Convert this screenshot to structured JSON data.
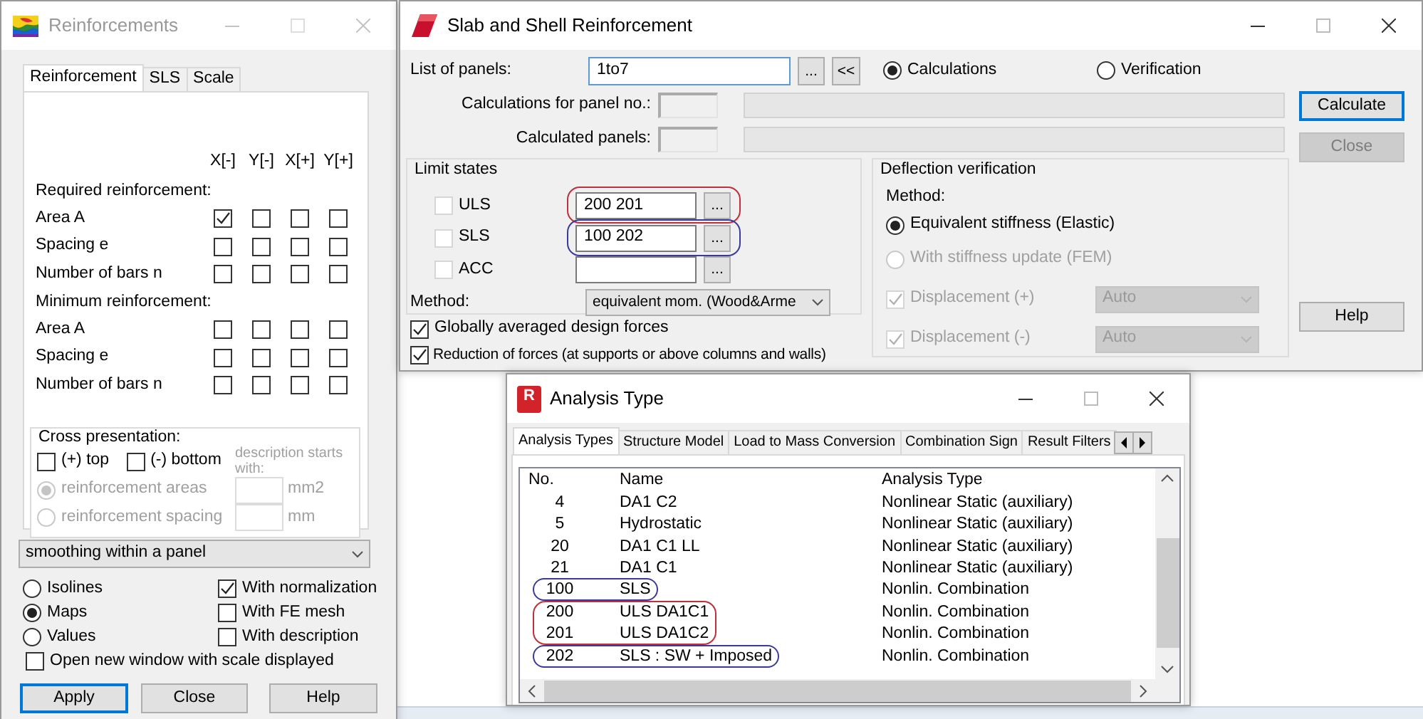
{
  "reinforcements_window": {
    "title": "Reinforcements",
    "active": false,
    "tabs": [
      {
        "label": "Reinforcement",
        "selected": true
      },
      {
        "label": "SLS",
        "selected": false
      },
      {
        "label": "Scale",
        "selected": false
      }
    ],
    "columns": [
      "X[-]",
      "Y[-]",
      "X[+]",
      "Y[+]"
    ],
    "sections": [
      {
        "heading": "Required reinforcement:",
        "rows": [
          {
            "label": "Area A",
            "checks": [
              true,
              false,
              false,
              false
            ]
          },
          {
            "label": "Spacing e",
            "checks": [
              false,
              false,
              false,
              false
            ]
          },
          {
            "label": "Number of bars n",
            "checks": [
              false,
              false,
              false,
              false
            ]
          }
        ]
      },
      {
        "heading": "Minimum reinforcement:",
        "rows": [
          {
            "label": "Area A",
            "checks": [
              false,
              false,
              false,
              false
            ]
          },
          {
            "label": "Spacing e",
            "checks": [
              false,
              false,
              false,
              false
            ]
          },
          {
            "label": "Number of bars n",
            "checks": [
              false,
              false,
              false,
              false
            ]
          }
        ]
      }
    ],
    "cross_presentation": {
      "title": "Cross presentation:",
      "top": {
        "label": "(+) top",
        "checked": false
      },
      "bottom": {
        "label": "(-) bottom",
        "checked": false
      },
      "hint": "description starts with:",
      "options": [
        {
          "label": "reinforcement areas",
          "selected": true,
          "disabled": true,
          "unit": "mm2"
        },
        {
          "label": "reinforcement spacing",
          "selected": false,
          "disabled": true,
          "unit": "mm"
        }
      ]
    },
    "smoothing": "smoothing within a panel",
    "display_modes": [
      {
        "label": "Isolines",
        "selected": false
      },
      {
        "label": "Maps",
        "selected": true
      },
      {
        "label": "Values",
        "selected": false
      }
    ],
    "display_options": [
      {
        "label": "With normalization",
        "checked": true
      },
      {
        "label": "With FE mesh",
        "checked": false
      },
      {
        "label": "With description",
        "checked": false
      }
    ],
    "open_new_window": {
      "label": "Open new window with scale displayed",
      "checked": false
    },
    "buttons": [
      {
        "label": "Apply",
        "default": true
      },
      {
        "label": "Close",
        "default": false
      },
      {
        "label": "Help",
        "default": false
      }
    ]
  },
  "slab_window": {
    "title": "Slab and Shell Reinforcement",
    "active": true,
    "list_of_panels": {
      "label": "List of panels:",
      "value": "1to7",
      "buttons": [
        "...",
        "<<"
      ]
    },
    "modes": [
      {
        "label": "Calculations",
        "selected": true
      },
      {
        "label": "Verification",
        "selected": false
      }
    ],
    "panel_fields": [
      {
        "label": "Calculations for panel no.:"
      },
      {
        "label": "Calculated panels:"
      }
    ],
    "limit_states": {
      "title": "Limit states",
      "items": [
        {
          "label": "ULS",
          "checked": false,
          "value": "200 201",
          "button": "...",
          "color": "#c0303a"
        },
        {
          "label": "SLS",
          "checked": false,
          "value": "100 202",
          "button": "...",
          "color": "#3a3a9c"
        },
        {
          "label": "ACC",
          "checked": false,
          "button": "..."
        }
      ],
      "method_label": "Method:",
      "method": "equivalent mom. (Wood&Arme"
    },
    "options": [
      {
        "label": "Globally averaged design forces",
        "checked": true
      },
      {
        "label": "Reduction of forces (at supports or above columns and walls)",
        "checked": true
      }
    ],
    "deflection": {
      "title": "Deflection verification",
      "method_label": "Method:",
      "methods": [
        {
          "label": "Equivalent stiffness (Elastic)",
          "selected": true,
          "disabled": false
        },
        {
          "label": "With stiffness update (FEM)",
          "selected": false,
          "disabled": true
        }
      ],
      "displacements": [
        {
          "label": "Displacement (+)",
          "checked": true,
          "disabled": true,
          "value": "Auto"
        },
        {
          "label": "Displacement (-)",
          "checked": true,
          "disabled": true,
          "value": "Auto"
        }
      ]
    },
    "buttons": [
      {
        "label": "Calculate",
        "default": true,
        "disabled": false
      },
      {
        "label": "Close",
        "default": false,
        "disabled": true
      },
      {
        "label": "Help",
        "default": false,
        "disabled": false
      }
    ]
  },
  "analysis_window": {
    "title": "Analysis Type",
    "active": true,
    "logo_letter": "R",
    "tabs": [
      {
        "label": "Analysis Types",
        "selected": true
      },
      {
        "label": "Structure Model",
        "selected": false
      },
      {
        "label": "Load to Mass Conversion",
        "selected": false
      },
      {
        "label": "Combination Sign",
        "selected": false
      },
      {
        "label": "Result Filters",
        "selected": false
      }
    ],
    "columns": [
      "No.",
      "Name",
      "Analysis Type"
    ],
    "rows": [
      {
        "no": "4",
        "name": "DA1 C2",
        "type": "Nonlinear Static (auxiliary)"
      },
      {
        "no": "5",
        "name": "Hydrostatic",
        "type": "Nonlinear Static (auxiliary)"
      },
      {
        "no": "20",
        "name": "DA1 C1 LL",
        "type": "Nonlinear Static (auxiliary)"
      },
      {
        "no": "21",
        "name": "DA1 C1",
        "type": "Nonlinear Static (auxiliary)"
      },
      {
        "no": "100",
        "name": "SLS",
        "type": "Nonlin. Combination",
        "color": "#3a3a9c"
      },
      {
        "no": "200",
        "name": "ULS DA1C1",
        "type": "Nonlin. Combination",
        "color": "#c0303a"
      },
      {
        "no": "201",
        "name": "ULS DA1C2",
        "type": "Nonlin. Combination",
        "color": "#c0303a"
      },
      {
        "no": "202",
        "name": "SLS : SW + Imposed",
        "type": "Nonlin. Combination",
        "color": "#3a3a9c"
      }
    ]
  }
}
